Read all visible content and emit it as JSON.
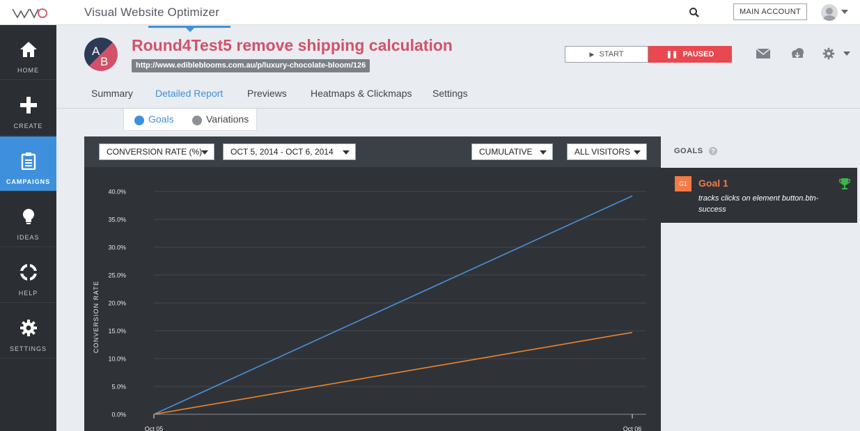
{
  "app": {
    "title": "Visual Website Optimizer",
    "account_button": "MAIN ACCOUNT"
  },
  "sidebar": {
    "items": [
      {
        "label": "HOME",
        "icon": "home-icon"
      },
      {
        "label": "CREATE",
        "icon": "plus-icon"
      },
      {
        "label": "CAMPAIGNS",
        "icon": "clipboard-icon",
        "active": true
      },
      {
        "label": "IDEAS",
        "icon": "lightbulb-icon"
      },
      {
        "label": "HELP",
        "icon": "lifebuoy-icon"
      },
      {
        "label": "SETTINGS",
        "icon": "gear-icon"
      }
    ]
  },
  "campaign": {
    "badge_a": "A",
    "badge_b": "B",
    "title": "Round4Test5 remove shipping calculation",
    "url": "http://www.edibleblooms.com.au/p/luxury-chocolate-bloom/126",
    "start_label": "START",
    "paused_label": "PAUSED"
  },
  "tabs": [
    {
      "label": "Summary"
    },
    {
      "label": "Detailed Report",
      "active": true
    },
    {
      "label": "Previews"
    },
    {
      "label": "Heatmaps & Clickmaps"
    },
    {
      "label": "Settings"
    }
  ],
  "subtoggle": {
    "goals_label": "Goals",
    "variations_label": "Variations"
  },
  "toolbar": {
    "metric": "CONVERSION RATE (%)",
    "date_range": "OCT 5, 2014 - OCT 6, 2014",
    "mode": "CUMULATIVE",
    "segment": "ALL VISITORS"
  },
  "goals_panel": {
    "heading": "GOALS",
    "help": "?",
    "goal_badge": "G1",
    "goal_name": "Goal 1",
    "goal_desc": "tracks clicks on element button.btn-success"
  },
  "colors": {
    "accent": "#3f90dc",
    "paused": "#e8484f",
    "title": "#d2526a",
    "goal": "#f47a46",
    "series_blue": "#4a90d9",
    "series_orange": "#f0842c"
  },
  "chart_data": {
    "type": "line",
    "ylabel": "CONVERSION RATE",
    "yticks": [
      "0.0%",
      "5.0%",
      "10.0%",
      "15.0%",
      "20.0%",
      "25.0%",
      "30.0%",
      "35.0%",
      "40.0%"
    ],
    "xticks": [
      "Oct 05",
      "Oct 06"
    ],
    "ylim": [
      0,
      40
    ],
    "x": [
      "Oct 05",
      "Oct 06"
    ],
    "series": [
      {
        "values": [
          0,
          39.2
        ],
        "color": "#4a90d9"
      },
      {
        "values": [
          0,
          14.7
        ],
        "color": "#f0842c"
      }
    ],
    "grid": true
  }
}
